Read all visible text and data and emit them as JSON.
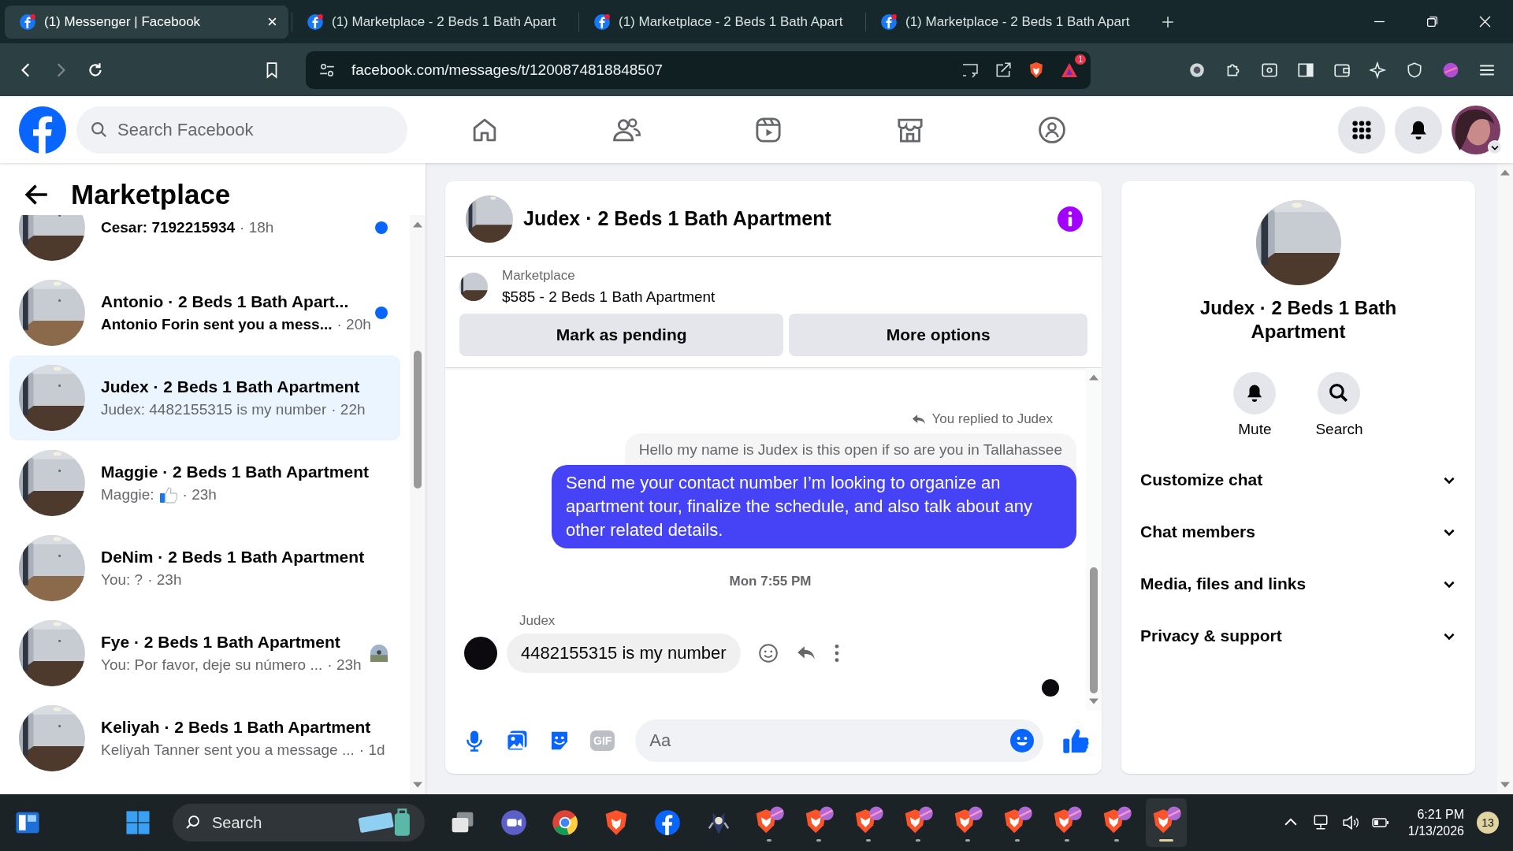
{
  "browser": {
    "tabs": [
      {
        "title": "(1) Messenger | Facebook",
        "selected": true
      },
      {
        "title": "(1) Marketplace - 2 Beds 1 Bath Apart",
        "selected": false
      },
      {
        "title": "(1) Marketplace - 2 Beds 1 Bath Apart",
        "selected": false
      },
      {
        "title": "(1) Marketplace - 2 Beds 1 Bath Apart",
        "selected": false
      }
    ],
    "address": "facebook.com/messages/t/1200874818848507",
    "alert_badge": "1"
  },
  "header": {
    "search_placeholder": "Search Facebook",
    "nav": [
      {
        "selected": false
      },
      {
        "selected": false
      },
      {
        "selected": false
      },
      {
        "selected": false
      },
      {
        "selected": false
      }
    ]
  },
  "sidebar": {
    "title": "Marketplace",
    "conversations": [
      {
        "preview": "Cesar: 7192215934",
        "time": "· 18h",
        "unread": true,
        "selected": false,
        "seen": false
      },
      {
        "name": "Antonio · 2 Beds 1 Bath Apart...",
        "preview": "Antonio Forin sent you a mess...",
        "time": "· 20h",
        "unread": true,
        "selected": false,
        "seen": false
      },
      {
        "name": "Judex · 2 Beds 1 Bath Apartment",
        "preview": "Judex: 4482155315 is my number",
        "time": "· 22h",
        "unread": false,
        "selected": true,
        "seen": false
      },
      {
        "name": "Maggie · 2 Beds 1 Bath Apartment",
        "preview": "Maggie:",
        "like_emoji": true,
        "time": "· 23h",
        "unread": false,
        "selected": false,
        "seen": false
      },
      {
        "name": "DeNim · 2 Beds 1 Bath Apartment",
        "preview": "You: ?",
        "time": "· 23h",
        "unread": false,
        "selected": false,
        "seen": false
      },
      {
        "name": "Fye · 2 Beds 1 Bath Apartment",
        "preview": "You: Por favor, deje su número ...",
        "time": "· 23h",
        "unread": false,
        "selected": false,
        "seen": true
      },
      {
        "name": "Keliyah · 2 Beds 1 Bath Apartment",
        "preview": "Keliyah Tanner sent you a message ...",
        "time": "· 1d",
        "unread": false,
        "selected": false,
        "seen": false
      }
    ]
  },
  "chat": {
    "title": "Judex · 2 Beds 1 Bath Apartment",
    "listing": {
      "label": "Marketplace",
      "title": "$585 - 2 Beds 1 Bath Apartment"
    },
    "buttons": [
      "Mark as pending",
      "More options"
    ],
    "messages": [
      {
        "kind": "reply_note",
        "text": "You replied to Judex"
      },
      {
        "kind": "quoted",
        "text": "Hello my name is Judex is this open if so are you in Tallahassee"
      },
      {
        "kind": "outgoing",
        "text": "Send me your contact number I’m looking to organize an apartment tour, finalize the schedule, and also talk about any other related details."
      },
      {
        "kind": "timestamp",
        "text": "Mon 7:55 PM"
      },
      {
        "kind": "sender",
        "text": "Judex"
      },
      {
        "kind": "incoming",
        "text": "4482155315 is my number"
      }
    ],
    "composer": {
      "placeholder": "Aa",
      "gif_label": "GIF"
    }
  },
  "details": {
    "title": "Judex · 2 Beds 1 Bath Apartment",
    "actions": [
      "Mute",
      "Search"
    ],
    "sections": [
      {
        "label": "Customize chat",
        "expanded": false
      },
      {
        "label": "Chat members",
        "expanded": false
      },
      {
        "label": "Media, files and links",
        "expanded": false
      },
      {
        "label": "Privacy & support",
        "expanded": false
      }
    ]
  },
  "taskbar": {
    "search_placeholder": "Search",
    "time": "6:21 PM",
    "date": "1/13/2026",
    "notifications": "13",
    "apps": [
      {
        "selected": false
      },
      {
        "selected": false
      },
      {
        "selected": false
      },
      {
        "selected": false
      },
      {
        "selected": false
      },
      {
        "selected": false
      },
      {
        "selected": false
      },
      {
        "selected": false
      },
      {
        "selected": true
      }
    ]
  }
}
